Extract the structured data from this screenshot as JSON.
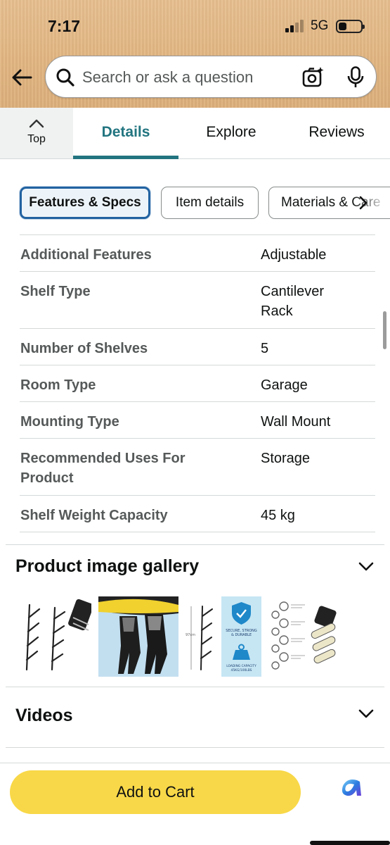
{
  "status_bar": {
    "time": "7:17",
    "network": "5G",
    "signal_bars": 2,
    "battery_level": 0.35
  },
  "search": {
    "placeholder": "Search or ask a question",
    "value": ""
  },
  "tabs": {
    "top_label": "Top",
    "items": [
      {
        "label": "Details",
        "active": true
      },
      {
        "label": "Explore",
        "active": false
      },
      {
        "label": "Reviews",
        "active": false
      }
    ]
  },
  "chips": [
    {
      "label": "Features & Specs",
      "active": true
    },
    {
      "label": "Item details",
      "active": false
    },
    {
      "label": "Materials & Care",
      "active": false
    }
  ],
  "specs": [
    {
      "key": "Additional Features",
      "value": "Adjustable"
    },
    {
      "key": "Shelf Type",
      "value": "Cantilever Rack"
    },
    {
      "key": "Number of Shelves",
      "value": "5"
    },
    {
      "key": "Room Type",
      "value": "Garage"
    },
    {
      "key": "Mounting Type",
      "value": "Wall Mount"
    },
    {
      "key": "Recommended Uses For Product",
      "value": "Storage"
    },
    {
      "key": "Shelf Weight Capacity",
      "value": "45 kg"
    }
  ],
  "gallery": {
    "title": "Product image gallery",
    "images": [
      {
        "name": "wall-mount-hooks-image"
      },
      {
        "name": "surfboard-wetsuit-image"
      },
      {
        "name": "rack-dimensions-image"
      },
      {
        "name": "load-capacity-infographic-image"
      },
      {
        "name": "features-infographic-image"
      }
    ],
    "infographic_text": [
      "SECURE, STRONG",
      "& DURABLE",
      "LOADING CAPACITY",
      "45KG/100LBS"
    ]
  },
  "videos": {
    "title": "Videos"
  },
  "bottom": {
    "add_to_cart_label": "Add to Cart"
  },
  "colors": {
    "accent": "#227580",
    "cart_button": "#f8d848",
    "chip_active_border": "#2162a1",
    "header_bg": "#e2b682"
  }
}
